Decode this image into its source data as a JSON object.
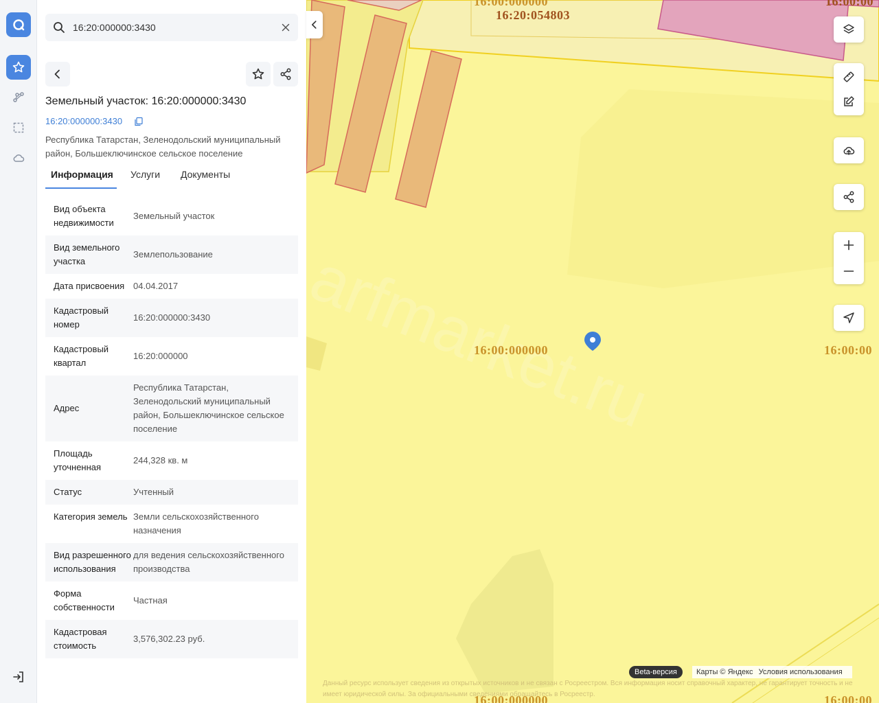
{
  "search": {
    "value": "16:20:000000:3430",
    "placeholder": ""
  },
  "header": {
    "title": "Земельный участок: 16:20:000000:3430",
    "cadastral_link": "16:20:000000:3430",
    "address": "Республика Татарстан, Зеленодольский муниципальный район, Большеключинское сельское поселение"
  },
  "tabs": [
    "Информация",
    "Услуги",
    "Документы"
  ],
  "info": [
    {
      "k": "Вид объекта недвижимости",
      "v": "Земельный участок"
    },
    {
      "k": "Вид земельного участка",
      "v": "Землепользование"
    },
    {
      "k": "Дата присвоения",
      "v": "04.04.2017"
    },
    {
      "k": "Кадастровый номер",
      "v": "16:20:000000:3430"
    },
    {
      "k": "Кадастровый квартал",
      "v": "16:20:000000"
    },
    {
      "k": "Адрес",
      "v": "Республика Татарстан, Зеленодольский муниципальный район, Большеключинское сельское поселение"
    },
    {
      "k": "Площадь уточненная",
      "v": "244,328 кв. м"
    },
    {
      "k": "Статус",
      "v": "Учтенный"
    },
    {
      "k": "Категория земель",
      "v": "Земли сельскохозяйственного назначения"
    },
    {
      "k": "Вид разрешенного использования",
      "v": "для ведения сельскохозяйственного производства"
    },
    {
      "k": "Форма собственности",
      "v": "Частная"
    },
    {
      "k": "Кадастровая стоимость",
      "v": "3,576,302.23 руб."
    }
  ],
  "map": {
    "labels": {
      "top_partial": "16:00:000000",
      "quarter_top": "16:20:054803",
      "top_right_partial": "16:00:00",
      "center": "16:00:000000",
      "right_partial": "16:00:00",
      "bottom": "16:00:000000",
      "bottom_right": "16:00:00"
    },
    "watermark": "arfmarket.ru",
    "beta": "Beta-версия",
    "attribution": [
      "Карты © Яндекс",
      "Условия использования"
    ],
    "disclaimer": "Данный ресурс использует сведения из открытых источников и не связан с Росреестром. Вся информация носит справочный характер, не гарантирует точность и не имеет юридической силы. За официальными сведениями обращайтесь в Росреестр."
  },
  "colors": {
    "accent": "#4a86e0",
    "map_fill": "#fbf59a",
    "plot_fill": "#e9b97a",
    "plot_stroke": "#d66a5a",
    "pink_plot": "#e0a0b8"
  }
}
